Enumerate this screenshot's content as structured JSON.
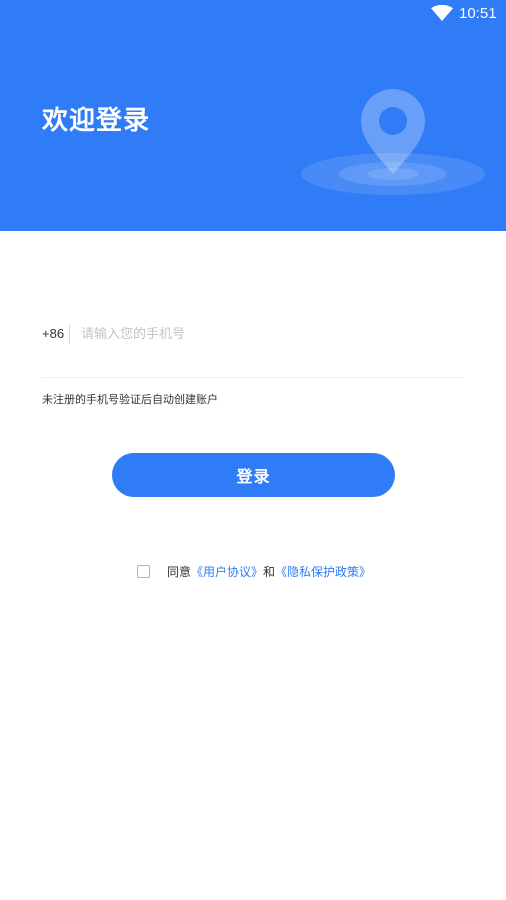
{
  "status_bar": {
    "time": "10:51",
    "wifi_icon": "wifi-icon"
  },
  "header": {
    "title": "欢迎登录",
    "background_color": "#2f7cf6",
    "illustration_icon": "location-pin-icon"
  },
  "form": {
    "country_code": "+86",
    "phone_placeholder": "请输入您的手机号",
    "phone_value": "",
    "hint": "未注册的手机号验证后自动创建账户",
    "login_label": "登录"
  },
  "agreement": {
    "checked": false,
    "prefix": "同意",
    "user_agreement": "《用户协议》",
    "conjunction": "和",
    "privacy_policy": "《隐私保护政策》",
    "link_color": "#2f7cf6"
  }
}
